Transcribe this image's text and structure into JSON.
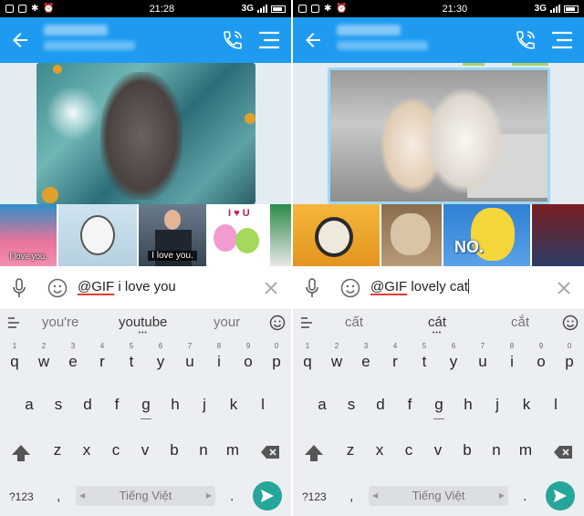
{
  "colors": {
    "appbar": "#1e9bf0",
    "accent_send": "#26a69a",
    "tag_underline": "#e53935",
    "status_bar": "#000000"
  },
  "screens": [
    {
      "status": {
        "time": "21:28",
        "network": "3G"
      },
      "input": {
        "tag": "@GIF",
        "query": " i love you"
      },
      "suggestions": [
        "you're",
        "youtube",
        "your"
      ],
      "gif_strip": [
        {
          "caption": "I love you."
        },
        {
          "caption": ""
        },
        {
          "caption": "I love you."
        },
        {
          "caption": "I ♥ U"
        },
        {
          "caption": ""
        }
      ]
    },
    {
      "status": {
        "time": "21:30",
        "network": "3G"
      },
      "input": {
        "tag": "@GIF",
        "query": " lovely cat"
      },
      "suggestions": [
        "cất",
        "cát",
        "cắt"
      ],
      "gif_strip": [
        {
          "caption": ""
        },
        {
          "caption": ""
        },
        {
          "caption": "NO."
        },
        {
          "caption": ""
        }
      ]
    }
  ],
  "keyboard": {
    "row1": [
      "q",
      "w",
      "e",
      "r",
      "t",
      "y",
      "u",
      "i",
      "o",
      "p"
    ],
    "row1_hints": [
      "1",
      "2",
      "3",
      "4",
      "5",
      "6",
      "7",
      "8",
      "9",
      "0"
    ],
    "row2": [
      "a",
      "s",
      "d",
      "f",
      "g",
      "h",
      "j",
      "k",
      "l"
    ],
    "row3": [
      "z",
      "x",
      "c",
      "v",
      "b",
      "n",
      "m"
    ],
    "symbols": "?123",
    "comma": ",",
    "space_label": "Tiếng Việt",
    "period": "."
  }
}
